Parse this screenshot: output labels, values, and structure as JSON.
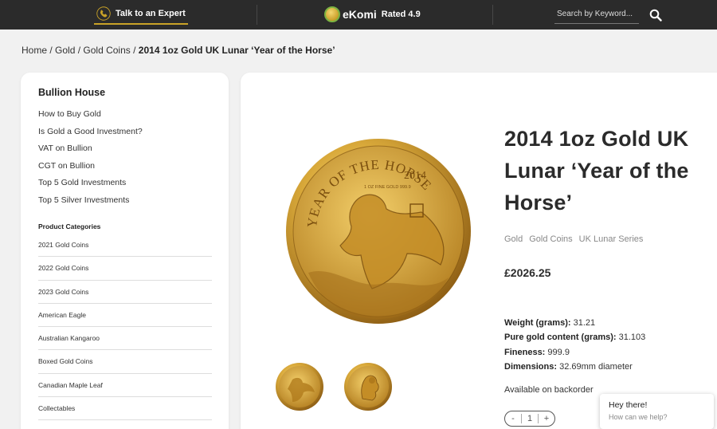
{
  "topbar": {
    "talk_label": "Talk to an Expert",
    "ekomi_brand": "eKomi",
    "ekomi_rated": "Rated 4.9",
    "search_placeholder": "Search by Keyword..."
  },
  "breadcrumb": {
    "items": [
      "Home",
      "Gold",
      "Gold Coins"
    ],
    "current": "2014 1oz Gold UK Lunar ‘Year of the Horse’"
  },
  "sidebar": {
    "title": "Bullion House",
    "links": [
      "How to Buy Gold",
      "Is Gold a Good Investment?",
      "VAT on Bullion",
      "CGT on Bullion",
      "Top 5 Gold Investments",
      "Top 5 Silver Investments"
    ],
    "categories_title": "Product Categories",
    "categories": [
      "2021 Gold Coins",
      "2022 Gold Coins",
      "2023 Gold Coins",
      "American Eagle",
      "Australian Kangaroo",
      "Boxed Gold Coins",
      "Canadian Maple Leaf",
      "Collectables"
    ]
  },
  "product": {
    "title": "2014 1oz Gold UK Lunar ‘Year of the Horse’",
    "tags": [
      "Gold",
      "Gold Coins",
      "UK Lunar Series"
    ],
    "price": "£2026.25",
    "specs": [
      {
        "label": "Weight (grams):",
        "value": "31.21"
      },
      {
        "label": "Pure gold content (grams):",
        "value": "31.103"
      },
      {
        "label": "Fineness:",
        "value": "999.9"
      },
      {
        "label": "Dimensions:",
        "value": "32.69mm diameter"
      }
    ],
    "availability": "Available on backorder",
    "quantity": {
      "minus": "-",
      "value": "1",
      "plus": "+"
    },
    "coin_text": {
      "top": "YEAR OF THE HORSE",
      "year": "2014",
      "sub": "1 OZ FINE GOLD 999.9"
    }
  },
  "chat": {
    "title": "Hey there!",
    "subtitle": "How can we help?"
  },
  "colors": {
    "topbar_bg": "#2b2b2b",
    "accent_gold": "#c9a227",
    "page_bg": "#f1f1f1"
  }
}
